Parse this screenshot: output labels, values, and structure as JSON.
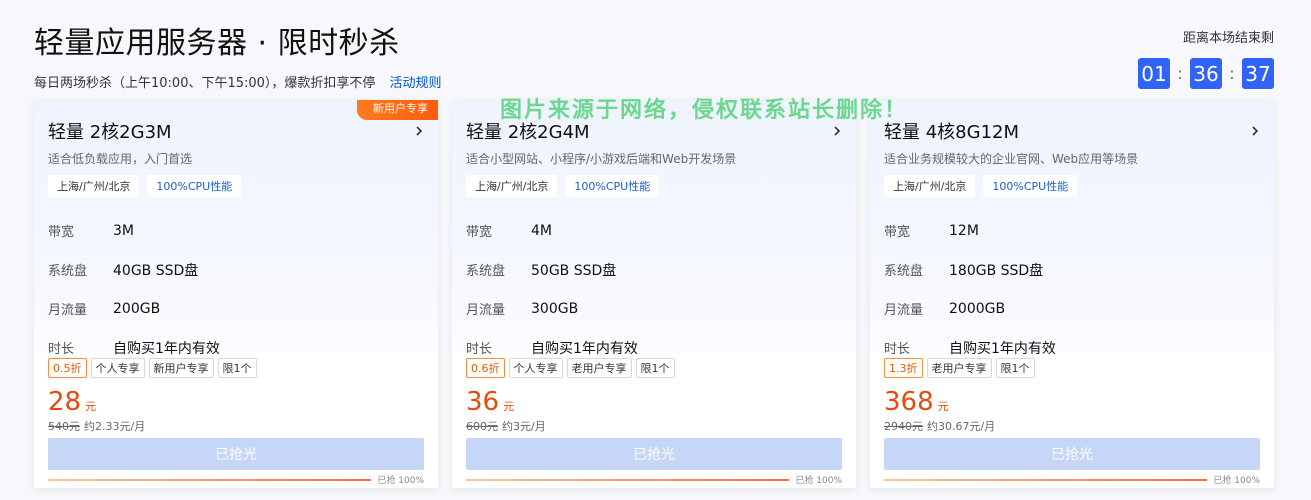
{
  "header": {
    "title": "轻量应用服务器 · 限时秒杀",
    "subtitle": "每日两场秒杀（上午10:00、下午15:00），爆款折扣享不停",
    "rules_link": "活动规则"
  },
  "countdown": {
    "label": "距离本场结束剩",
    "hours": "01",
    "minutes": "36",
    "seconds": "37",
    "separator": ":"
  },
  "watermark": "图片来源于网络，侵权联系站长删除！",
  "spec_labels": {
    "bandwidth": "带宽",
    "disk": "系统盘",
    "traffic": "月流量",
    "duration": "时长"
  },
  "cards": [
    {
      "ribbon": "新用户专享",
      "name": "轻量 2核2G3M",
      "desc": "适合低负载应用，入门首选",
      "tag_region": "上海/广州/北京",
      "tag_cpu": "100%CPU性能",
      "bandwidth": "3M",
      "disk": "40GB SSD盘",
      "traffic": "200GB",
      "duration": "自购买1年内有效",
      "discount": "0.5折",
      "badges": [
        "个人专享",
        "新用户专享",
        "限1个"
      ],
      "price": "28",
      "unit": "元",
      "orig_price": "540元",
      "monthly": "约2.33元/月",
      "button": "已抢光",
      "progress_label": "已抢 100%",
      "progress": 1.0
    },
    {
      "ribbon": "",
      "name": "轻量 2核2G4M",
      "desc": "适合小型网站、小程序/小游戏后端和Web开发场景",
      "tag_region": "上海/广州/北京",
      "tag_cpu": "100%CPU性能",
      "bandwidth": "4M",
      "disk": "50GB SSD盘",
      "traffic": "300GB",
      "duration": "自购买1年内有效",
      "discount": "0.6折",
      "badges": [
        "个人专享",
        "老用户专享",
        "限1个"
      ],
      "price": "36",
      "unit": "元",
      "orig_price": "600元",
      "monthly": "约3元/月",
      "button": "已抢光",
      "progress_label": "已抢 100%",
      "progress": 1.0
    },
    {
      "ribbon": "",
      "name": "轻量 4核8G12M",
      "desc": "适合业务规模较大的企业官网、Web应用等场景",
      "tag_region": "上海/广州/北京",
      "tag_cpu": "100%CPU性能",
      "bandwidth": "12M",
      "disk": "180GB SSD盘",
      "traffic": "2000GB",
      "duration": "自购买1年内有效",
      "discount": "1.3折",
      "badges": [
        "老用户专享",
        "限1个"
      ],
      "price": "368",
      "unit": "元",
      "orig_price": "2940元",
      "monthly": "约30.67元/月",
      "button": "已抢光",
      "progress_label": "已抢 100%",
      "progress": 1.0
    }
  ],
  "colors": {
    "accent_blue": "#3163f7",
    "price_orange": "#e64b0d",
    "sold_out_button": "#c5d6f6"
  }
}
